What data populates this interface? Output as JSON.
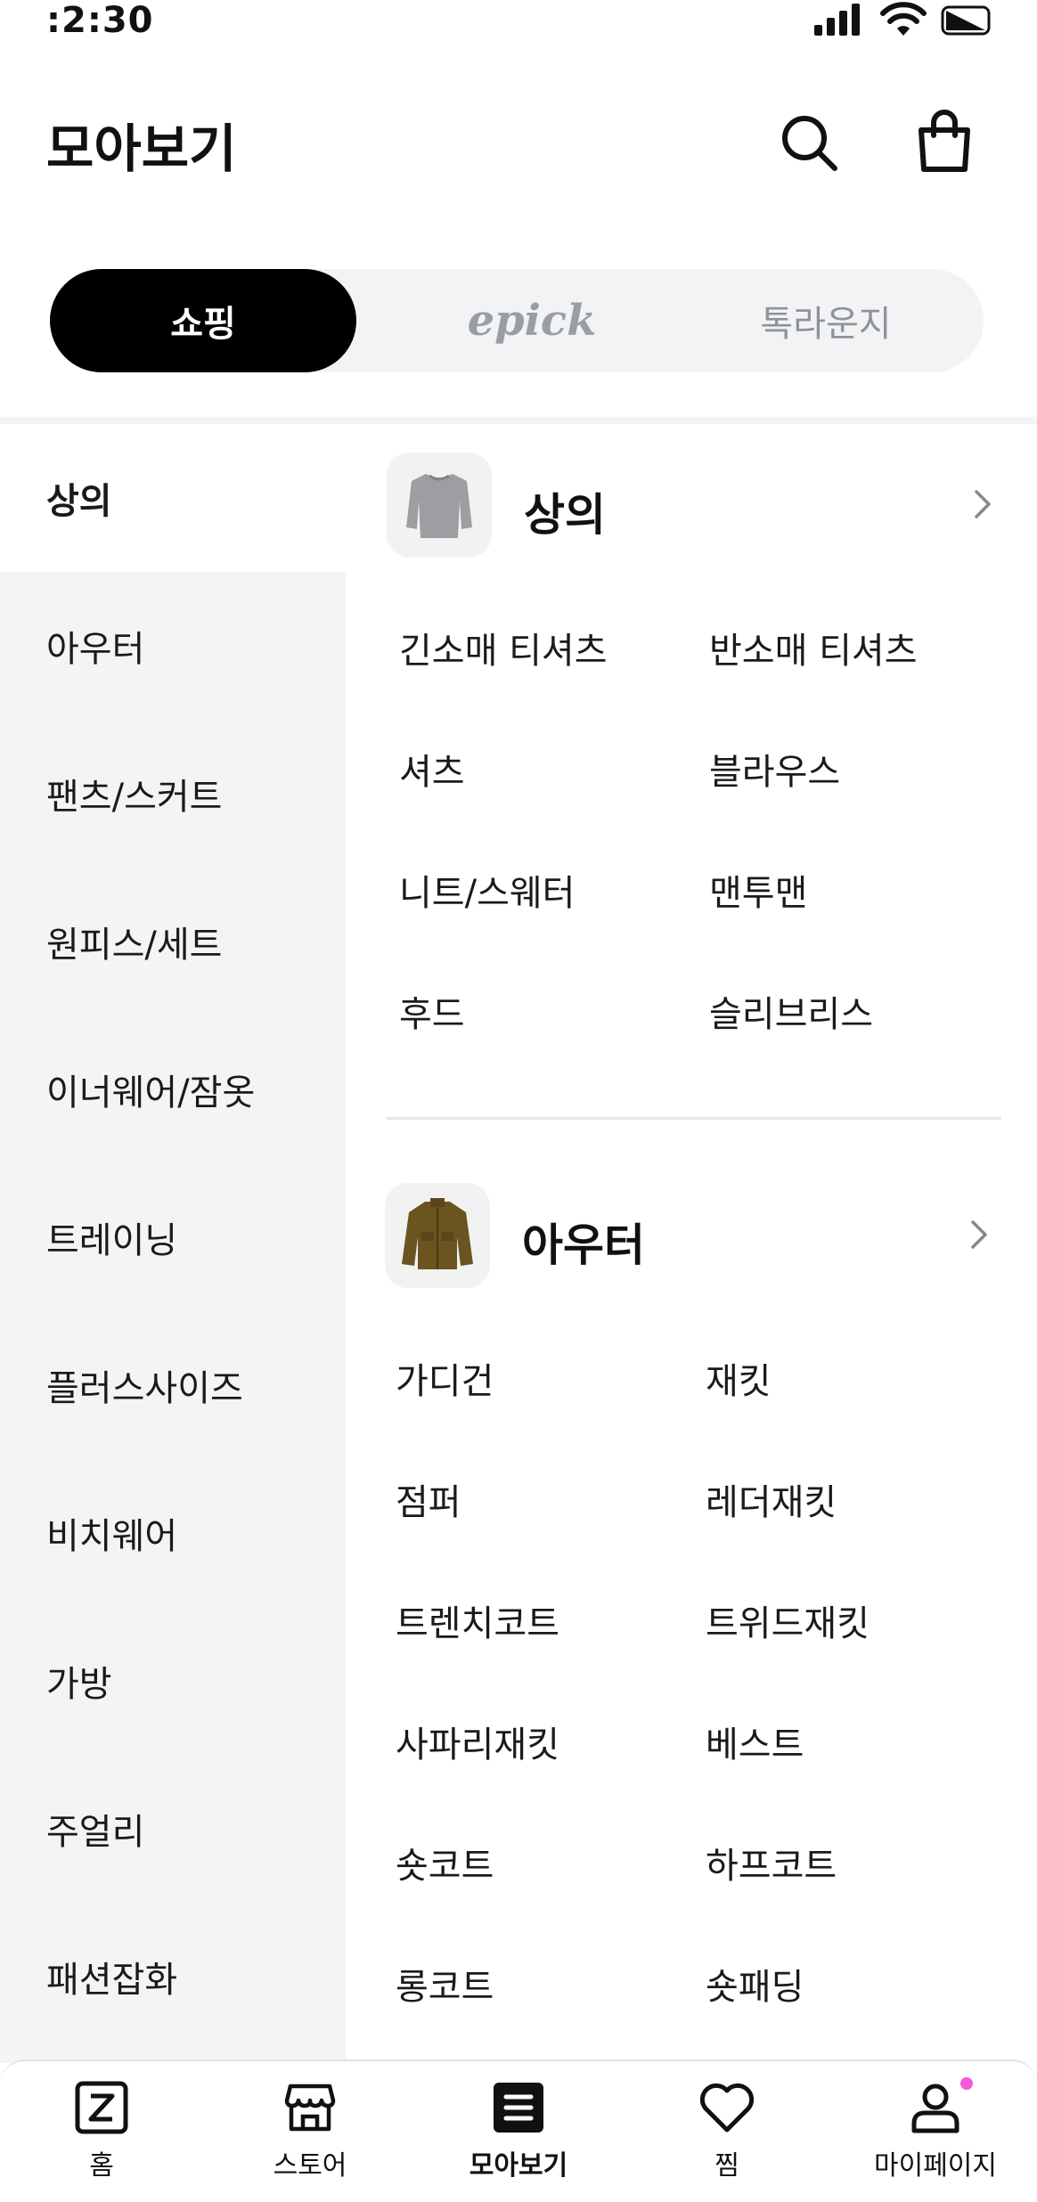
{
  "status": {
    "time": ":2:30"
  },
  "header": {
    "title": "모아보기"
  },
  "segment": {
    "tabs": [
      "쇼핑",
      "epick",
      "톡라운지"
    ],
    "active": "쇼핑"
  },
  "sidebar": {
    "items": [
      "상의",
      "아우터",
      "팬츠/스커트",
      "원피스/세트",
      "이너웨어/잠옷",
      "트레이닝",
      "플러스사이즈",
      "비치웨어",
      "가방",
      "주얼리",
      "패션잡화"
    ],
    "active": "상의"
  },
  "categories": [
    {
      "title": "상의",
      "thumb_icon": "sweater-icon",
      "items": [
        "긴소매 티셔츠",
        "반소매 티셔츠",
        "셔츠",
        "블라우스",
        "니트/스웨터",
        "맨투맨",
        "후드",
        "슬리브리스"
      ]
    },
    {
      "title": "아우터",
      "thumb_icon": "jacket-icon",
      "items": [
        "가디건",
        "재킷",
        "점퍼",
        "레더재킷",
        "트렌치코트",
        "트위드재킷",
        "사파리재킷",
        "베스트",
        "숏코트",
        "하프코트",
        "롱코트",
        "숏패딩"
      ]
    }
  ],
  "bottom_nav": {
    "items": [
      {
        "label": "홈",
        "icon": "home-z-icon"
      },
      {
        "label": "스토어",
        "icon": "store-icon"
      },
      {
        "label": "모아보기",
        "icon": "list-icon"
      },
      {
        "label": "찜",
        "icon": "heart-icon"
      },
      {
        "label": "마이페이지",
        "icon": "person-icon"
      }
    ],
    "active": "모아보기"
  },
  "colors": {
    "accent": "#000000",
    "sidebar_bg": "#f3f4f6",
    "segment_bg": "#f2f3f4",
    "badge_dot": "#f25ad8"
  }
}
